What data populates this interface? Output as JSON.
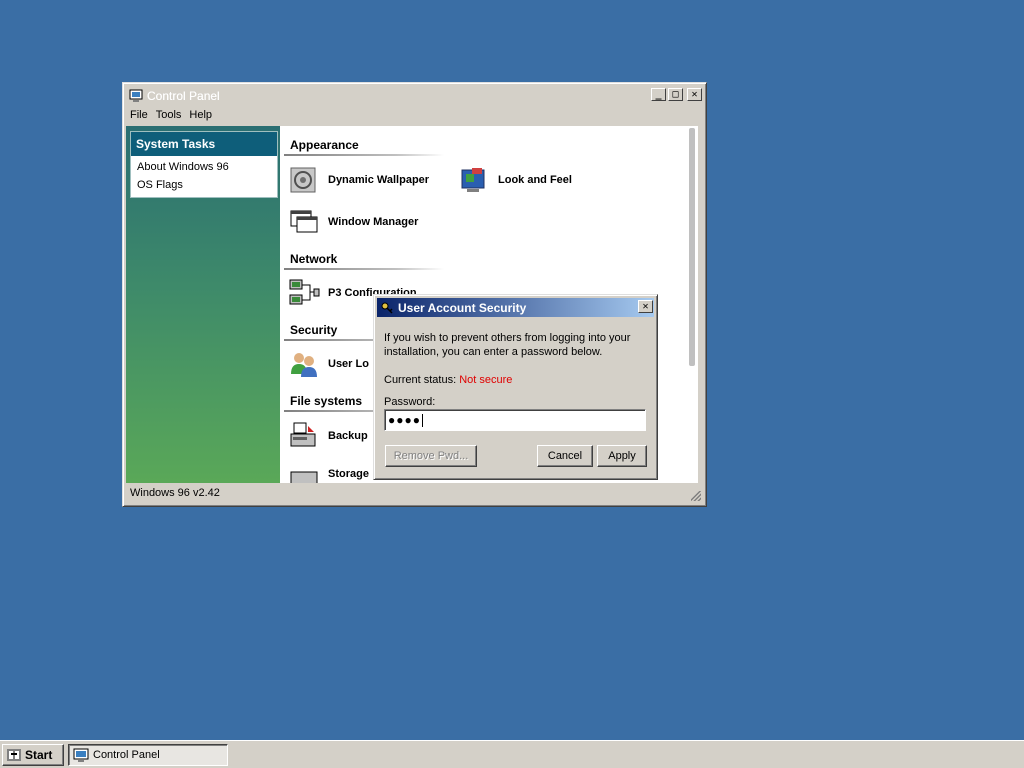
{
  "window": {
    "title": "Control Panel",
    "menu": [
      "File",
      "Tools",
      "Help"
    ],
    "status": "Windows 96 v2.42"
  },
  "sidebar": {
    "heading": "System Tasks",
    "links": [
      "About Windows 96",
      "OS Flags"
    ]
  },
  "sections": {
    "appearance": "Appearance",
    "network": "Network",
    "security": "Security",
    "filesystems": "File systems"
  },
  "items": {
    "dynamic_wallpaper": "Dynamic Wallpaper",
    "look_and_feel": "Look and Feel",
    "window_manager": "Window Manager",
    "p3_configuration": "P3 Configuration",
    "user_accounts": "User Lo",
    "backup": "Backup",
    "storage": "Storage"
  },
  "dialog": {
    "title": "User Account Security",
    "message": "If you wish to prevent others from logging into your installation, you can enter a password below.",
    "status_label": "Current status:",
    "status_value": "Not secure",
    "password_label": "Password:",
    "password_value": "●●●●",
    "remove_btn": "Remove Pwd...",
    "cancel_btn": "Cancel",
    "apply_btn": "Apply"
  },
  "taskbar": {
    "start": "Start",
    "task": "Control Panel"
  },
  "colors": {
    "desktop": "#3a6ea5",
    "status_bad": "#e00000"
  }
}
